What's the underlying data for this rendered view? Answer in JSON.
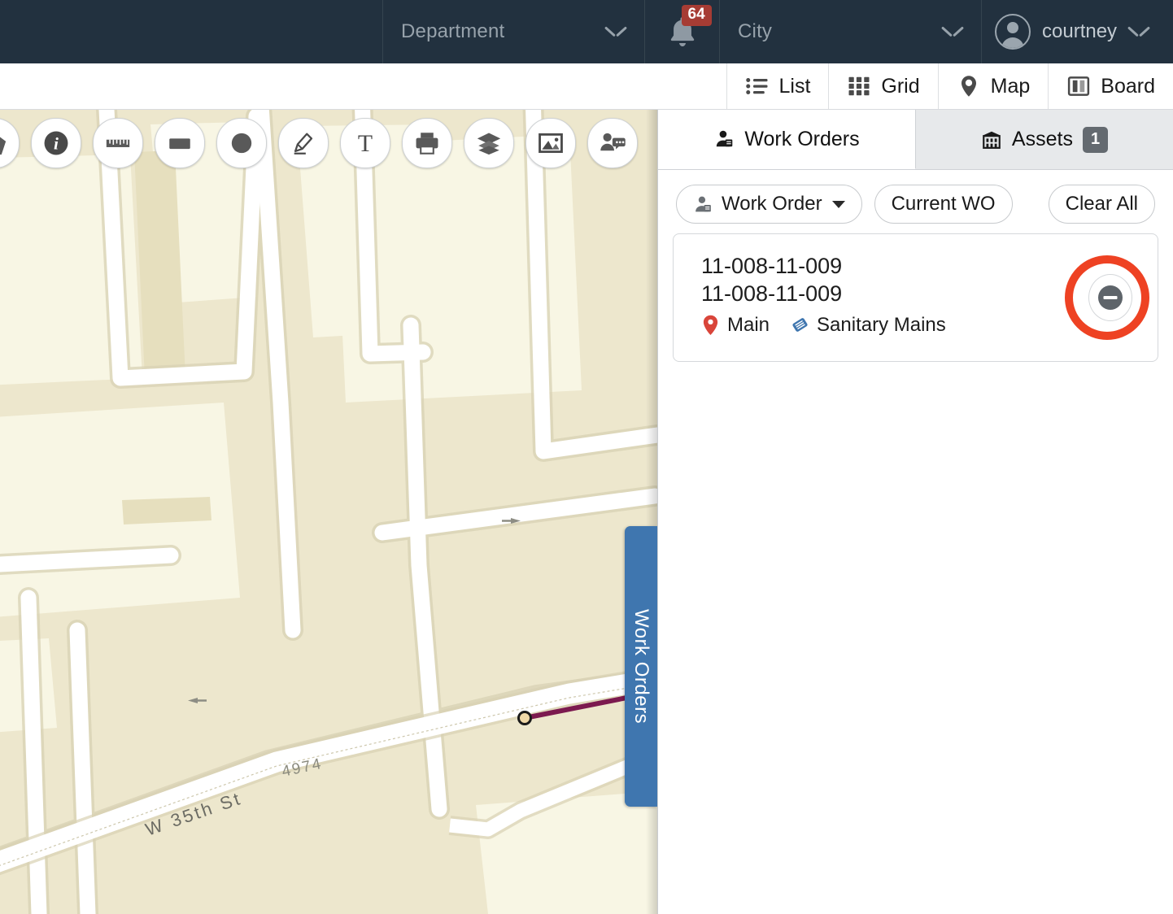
{
  "header": {
    "department_select": {
      "label": "Department",
      "icon": "chevron-down-icon"
    },
    "notifications": {
      "icon": "bell-icon",
      "count": "64"
    },
    "city_select": {
      "label": "City",
      "icon": "chevron-down-icon"
    },
    "user_menu": {
      "name": "courtney",
      "icon": "user-avatar-icon"
    }
  },
  "view_switch": {
    "buttons": [
      {
        "label": "List",
        "icon": "list-icon"
      },
      {
        "label": "Grid",
        "icon": "grid-icon"
      },
      {
        "label": "Map",
        "icon": "map-pin-icon"
      },
      {
        "label": "Board",
        "icon": "board-icon"
      }
    ]
  },
  "map": {
    "tools": [
      {
        "name": "polygon-tool",
        "icon": "pentagon-icon"
      },
      {
        "name": "info-tool",
        "icon": "info-icon"
      },
      {
        "name": "measure-tool",
        "icon": "ruler-icon"
      },
      {
        "name": "rectangle-tool",
        "icon": "rectangle-icon"
      },
      {
        "name": "circle-tool",
        "icon": "circle-icon"
      },
      {
        "name": "freehand-tool",
        "icon": "pen-icon"
      },
      {
        "name": "text-tool",
        "icon": "text-icon"
      },
      {
        "name": "print-tool",
        "icon": "printer-icon"
      },
      {
        "name": "layers-tool",
        "icon": "layers-icon"
      },
      {
        "name": "image-tool",
        "icon": "image-icon"
      },
      {
        "name": "request-tool",
        "icon": "person-comment-icon"
      }
    ],
    "side_tab_label": "Work Orders",
    "labels": [
      {
        "text": "W 35th St",
        "type": "street"
      },
      {
        "text": "4974",
        "type": "address"
      }
    ],
    "colors": {
      "land": "#ede7cd",
      "block": "#f8f6e4",
      "road": "#ffffff",
      "feature_line": "#7c1a4f",
      "side_tab": "#3f76af"
    }
  },
  "panel": {
    "tabs": [
      {
        "label": "Work Orders",
        "icon": "work-order-icon",
        "active": true,
        "count": ""
      },
      {
        "label": "Assets",
        "icon": "building-icon",
        "active": false,
        "count": "1"
      }
    ],
    "filters": {
      "type_filter": {
        "label": "Work Order",
        "icon": "work-order-icon",
        "caret": "caret-down-icon"
      },
      "current_wo": {
        "label": "Current WO"
      },
      "clear_all": {
        "label": "Clear All"
      }
    },
    "cards": [
      {
        "title": "11-008-11-009",
        "subtitle": "11-008-11-009",
        "meta": [
          {
            "label": "Main",
            "icon": "map-pin-icon",
            "color": "#d9453a"
          },
          {
            "label": "Sanitary Mains",
            "icon": "asset-diamond-icon",
            "color": "#3f76af"
          }
        ],
        "action": {
          "name": "remove-button",
          "icon": "minus-circle-icon"
        }
      }
    ]
  },
  "annotation": {
    "highlight_color": "#ee4223",
    "target": "remove-button"
  }
}
